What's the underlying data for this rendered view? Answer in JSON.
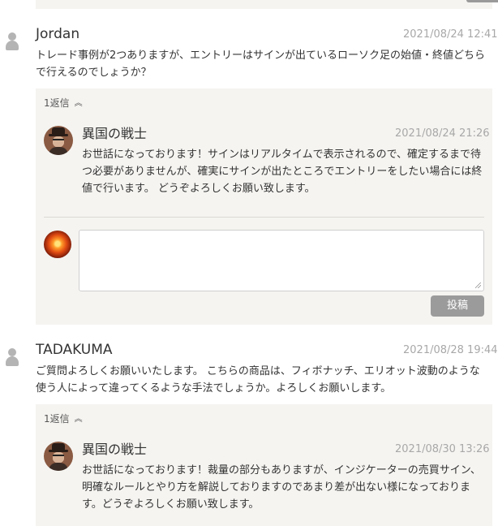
{
  "comments": [
    {
      "author": "Jordan",
      "date": "2021/08/24 12:41",
      "text": "トレード事例が2つありますが、エントリーはサインが出ているローソク足の始値・終値どちらで行えるのでしょうか？",
      "reply_count": "1返信",
      "reply": {
        "author": "異国の戦士",
        "date": "2021/08/24 21:26",
        "text": "お世話になっております！サインはリアルタイムで表示されるので、確定するまで待つ必要がありませんが、確実にサインが出たところでエントリーをしたい場合には終値で行います。 どうぞよろしくお願い致します。"
      },
      "reply_form": {
        "textarea_value": "",
        "submit_label": "投稿"
      }
    },
    {
      "author": "TADAKUMA",
      "date": "2021/08/28 19:44",
      "text": "ご質問よろしくお願いいたします。 こちらの商品は、フィボナッチ、エリオット波動のような使う人によって違ってくるような手法でしょうか。よろしくお願いします。",
      "reply_count": "1返信",
      "reply": {
        "author": "異国の戦士",
        "date": "2021/08/30 13:26",
        "text": "お世話になっております！裁量の部分もありますが、インジケーターの売買サイン、明確なルールとやり方を解説しておりますのであまり差が出ない様になっております。どうぞよろしくお願い致します。"
      }
    }
  ],
  "icons": {
    "user": "user-silhouette-icon",
    "collapse": "chevron-double-up-icon",
    "author_avatar": "author-avatar",
    "self_avatar": "current-user-avatar"
  },
  "colors": {
    "reply_background": "#f5f4f1",
    "post_button": "#9b9b9b",
    "date_text": "#a8a8a8"
  }
}
